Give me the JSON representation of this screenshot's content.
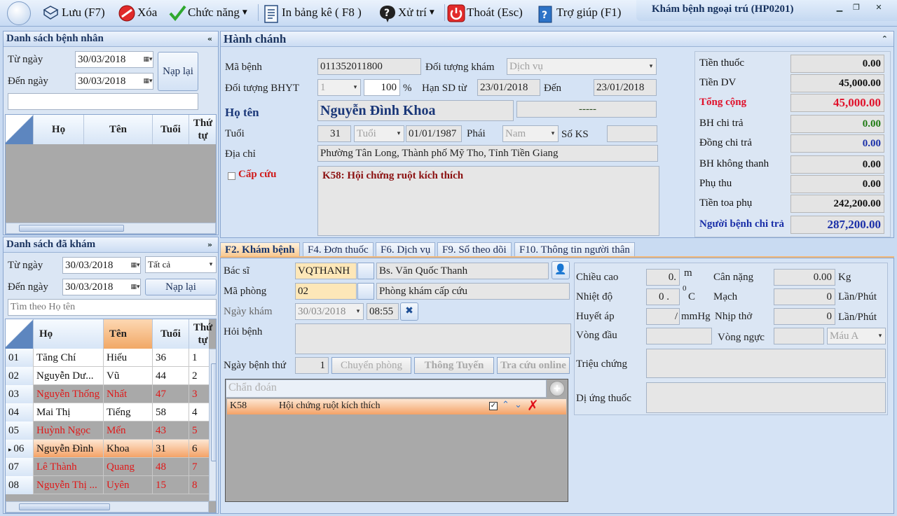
{
  "toolbar": {
    "save": "Lưu (F7)",
    "delete": "Xóa",
    "functions": "Chức năng",
    "print": "In bảng kê ( F8 )",
    "handle": "Xử trí",
    "exit": "Thoát (Esc)",
    "help": "Trợ giúp (F1)"
  },
  "window": {
    "title": "Khám bệnh ngoại trú (HP0201)"
  },
  "patient_list": {
    "title": "Danh sách bệnh nhân",
    "from_label": "Từ ngày",
    "to_label": "Đến ngày",
    "from_date": "30/03/2018",
    "to_date": "30/03/2018",
    "reload": "Nạp lại",
    "columns": [
      "Họ",
      "Tên",
      "Tuổi",
      "Thứ tự"
    ]
  },
  "examined_list": {
    "title": "Danh sách đã khám",
    "from_label": "Từ ngày",
    "to_label": "Đến ngày",
    "from_date": "30/03/2018",
    "to_date": "30/03/2018",
    "filter": "Tất cả",
    "reload": "Nạp lại",
    "search_placeholder": "Tìm theo Họ tên",
    "columns": [
      "Họ",
      "Tên",
      "Tuổi",
      "Thứ tự"
    ],
    "rows": [
      {
        "no": "01",
        "ho": "Tăng Chí",
        "ten": "Hiếu",
        "tuoi": "36",
        "tt": "1",
        "red": false,
        "sel": false
      },
      {
        "no": "02",
        "ho": "Nguyễn Dư...",
        "ten": "Vũ",
        "tuoi": "44",
        "tt": "2",
        "red": false,
        "sel": false
      },
      {
        "no": "03",
        "ho": "Nguyễn Thống",
        "ten": "Nhất",
        "tuoi": "47",
        "tt": "3",
        "red": true,
        "sel": false
      },
      {
        "no": "04",
        "ho": "Mai Thị",
        "ten": "Tiếng",
        "tuoi": "58",
        "tt": "4",
        "red": false,
        "sel": false
      },
      {
        "no": "05",
        "ho": "Huỳnh Ngọc",
        "ten": "Mến",
        "tuoi": "43",
        "tt": "5",
        "red": true,
        "sel": false
      },
      {
        "no": "06",
        "ho": "Nguyễn Đình",
        "ten": "Khoa",
        "tuoi": "31",
        "tt": "6",
        "red": false,
        "sel": true
      },
      {
        "no": "07",
        "ho": "Lê Thành",
        "ten": "Quang",
        "tuoi": "48",
        "tt": "7",
        "red": true,
        "sel": false
      },
      {
        "no": "08",
        "ho": "Nguyễn Thị ...",
        "ten": "Uyên",
        "tuoi": "15",
        "tt": "8",
        "red": true,
        "sel": false
      }
    ]
  },
  "admin": {
    "title": "Hành chánh",
    "ma_benh_label": "Mã bệnh",
    "ma_benh": "011352011800",
    "doi_tuong_kham_label": "Đối tượng khám",
    "doi_tuong_kham": "Dịch vụ",
    "bhyt_label": "Đối tượng BHYT",
    "bhyt": "1",
    "percent": "100",
    "percent_sign": "%",
    "han_sd_label": "Hạn SD từ",
    "han_sd_tu": "23/01/2018",
    "den_label": "Đến",
    "han_sd_den": "23/01/2018",
    "ho_ten_label": "Họ tên",
    "ho_ten": "Nguyễn Đình Khoa",
    "extra": "-----",
    "tuoi_label": "Tuổi",
    "tuoi": "31",
    "tuoi_unit": "Tuổi",
    "dob": "01/01/1987",
    "phai_label": "Phái",
    "phai": "Nam",
    "so_ks_label": "Số KS",
    "dia_chi_label": "Địa chỉ",
    "dia_chi": "Phường Tân Long, Thành phố Mỹ Tho, Tỉnh Tiền Giang",
    "cap_cuu_label": "Cấp cứu",
    "diagnosis_note": "K58: Hội chứng ruột kích thích"
  },
  "fees": [
    {
      "label": "Tiền thuốc",
      "value": "0.00",
      "color": "#111111",
      "label_color": "#111111"
    },
    {
      "label": "Tiền DV",
      "value": "45,000.00",
      "color": "#111111",
      "label_color": "#111111"
    },
    {
      "label": "Tổng cộng",
      "value": "45,000.00",
      "color": "#e0102a",
      "label_color": "#e0102a"
    },
    {
      "label": "BH chi trả",
      "value": "0.00",
      "color": "#1e7a12",
      "label_color": "#111111"
    },
    {
      "label": "Đồng chi trả",
      "value": "0.00",
      "color": "#1a2fa8",
      "label_color": "#111111"
    },
    {
      "label": "BH không thanh",
      "value": "0.00",
      "color": "#111111",
      "label_color": "#111111"
    },
    {
      "label": "Phụ thu",
      "value": "0.00",
      "color": "#111111",
      "label_color": "#111111"
    },
    {
      "label": "Tiền toa phụ",
      "value": "242,200.00",
      "color": "#111111",
      "label_color": "#111111"
    },
    {
      "label": "Người bệnh chi trả",
      "value": "287,200.00",
      "color": "#1a2fa8",
      "label_color": "#1a2fa8"
    }
  ],
  "tabs": [
    "F2. Khám bệnh",
    "F4. Đơn thuốc",
    "F6. Dịch vụ",
    "F9. Sổ theo dõi",
    "F10. Thông tin người thân"
  ],
  "exam": {
    "bac_si_label": "Bác sĩ",
    "bac_si_code": "VQTHANH",
    "bac_si_name": "Bs. Văn Quốc Thanh",
    "ma_phong_label": "Mã phòng",
    "ma_phong_code": "02",
    "ma_phong_name": "Phòng khám cấp cứu",
    "ngay_kham_label": "Ngày khám",
    "ngay_kham": "30/03/2018",
    "gio_kham": "08:55",
    "hoi_benh_label": "Hỏi bệnh",
    "ngay_benh_label": "Ngày bệnh thứ",
    "ngay_benh": "1",
    "chuyen_phong": "Chuyển phòng",
    "thong_tuyen": "Thông Tuyến",
    "tra_cuu": "Tra cứu online",
    "chan_doan_placeholder": "Chẩn đoán",
    "diag_code": "K58",
    "diag_name": "Hội chứng ruột kích thích"
  },
  "vitals": {
    "chieu_cao_label": "Chiều cao",
    "chieu_cao": "0.",
    "chieu_cao_unit": "m",
    "can_nang_label": "Cân nặng",
    "can_nang": "0.00",
    "can_nang_unit": "Kg",
    "nhiet_do_label": "Nhiệt độ",
    "nhiet_do": "0 .",
    "nhiet_do_unit_sup": "0",
    "nhiet_do_unit": "C",
    "mach_label": "Mạch",
    "mach": "0",
    "mach_unit": "Lần/Phút",
    "huyet_ap_label": "Huyết áp",
    "huyet_ap": "/",
    "huyet_ap_unit": "mmHg",
    "nhip_tho_label": "Nhịp thở",
    "nhip_tho": "0",
    "nhip_tho_unit": "Lần/Phút",
    "vong_dau_label": "Vòng đầu",
    "vong_nguc_label": "Vòng ngực",
    "mau": "Máu A",
    "trieu_chung_label": "Triệu chứng",
    "di_ung_label": "Dị ứng thuốc"
  }
}
